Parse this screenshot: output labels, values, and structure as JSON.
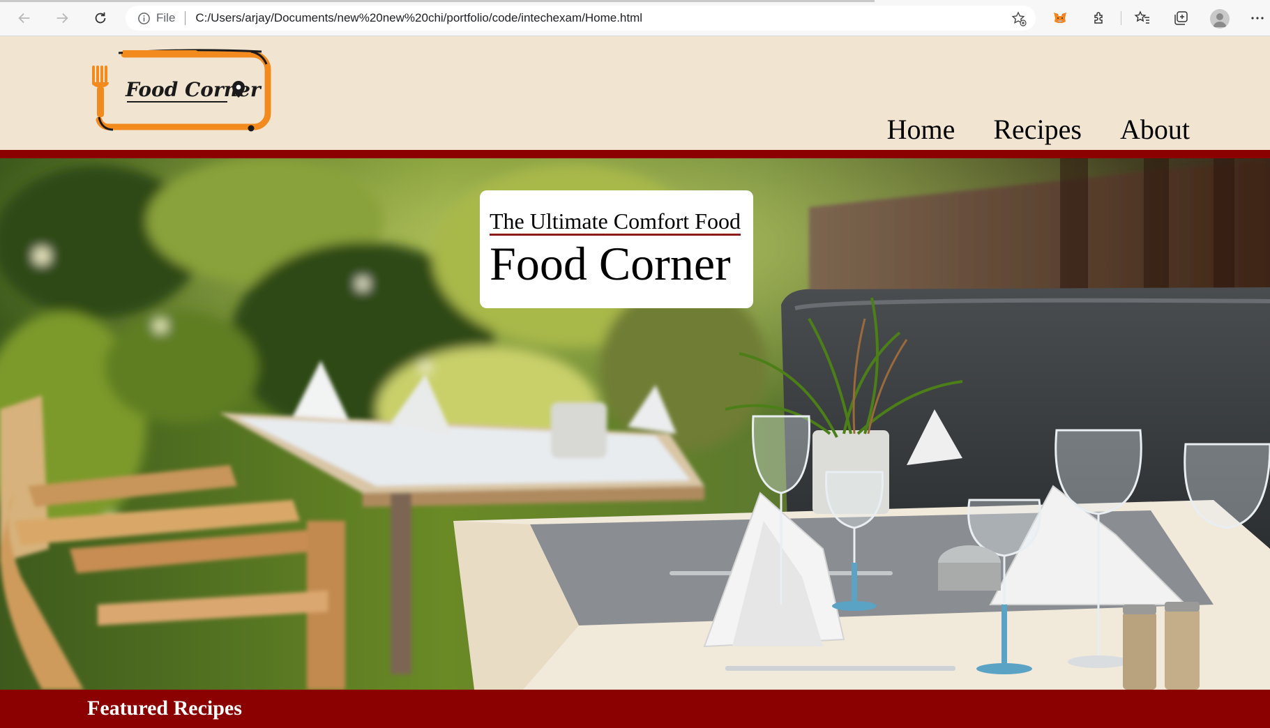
{
  "browser": {
    "file_label": "File",
    "url": "C:/Users/arjay/Documents/new%20new%20chi/portfolio/code/intechexam/Home.html",
    "icons": [
      "back-icon",
      "forward-icon",
      "refresh-icon",
      "info-icon",
      "add-favorite-icon",
      "metamask-fox-icon",
      "extensions-icon",
      "favorites-icon",
      "collections-icon",
      "profile-icon",
      "more-icon"
    ]
  },
  "site": {
    "logo_text": "Food Corner",
    "nav": [
      {
        "label": "Home"
      },
      {
        "label": "Recipes"
      },
      {
        "label": "About"
      }
    ],
    "hero": {
      "tagline": "The Ultimate Comfort Food",
      "brand": "Food Corner"
    },
    "featured": {
      "title": "Featured Recipes"
    }
  },
  "colors": {
    "header_bg": "#f1e4d1",
    "accent_red": "#8b0000",
    "logo_orange": "#f28a1e"
  }
}
